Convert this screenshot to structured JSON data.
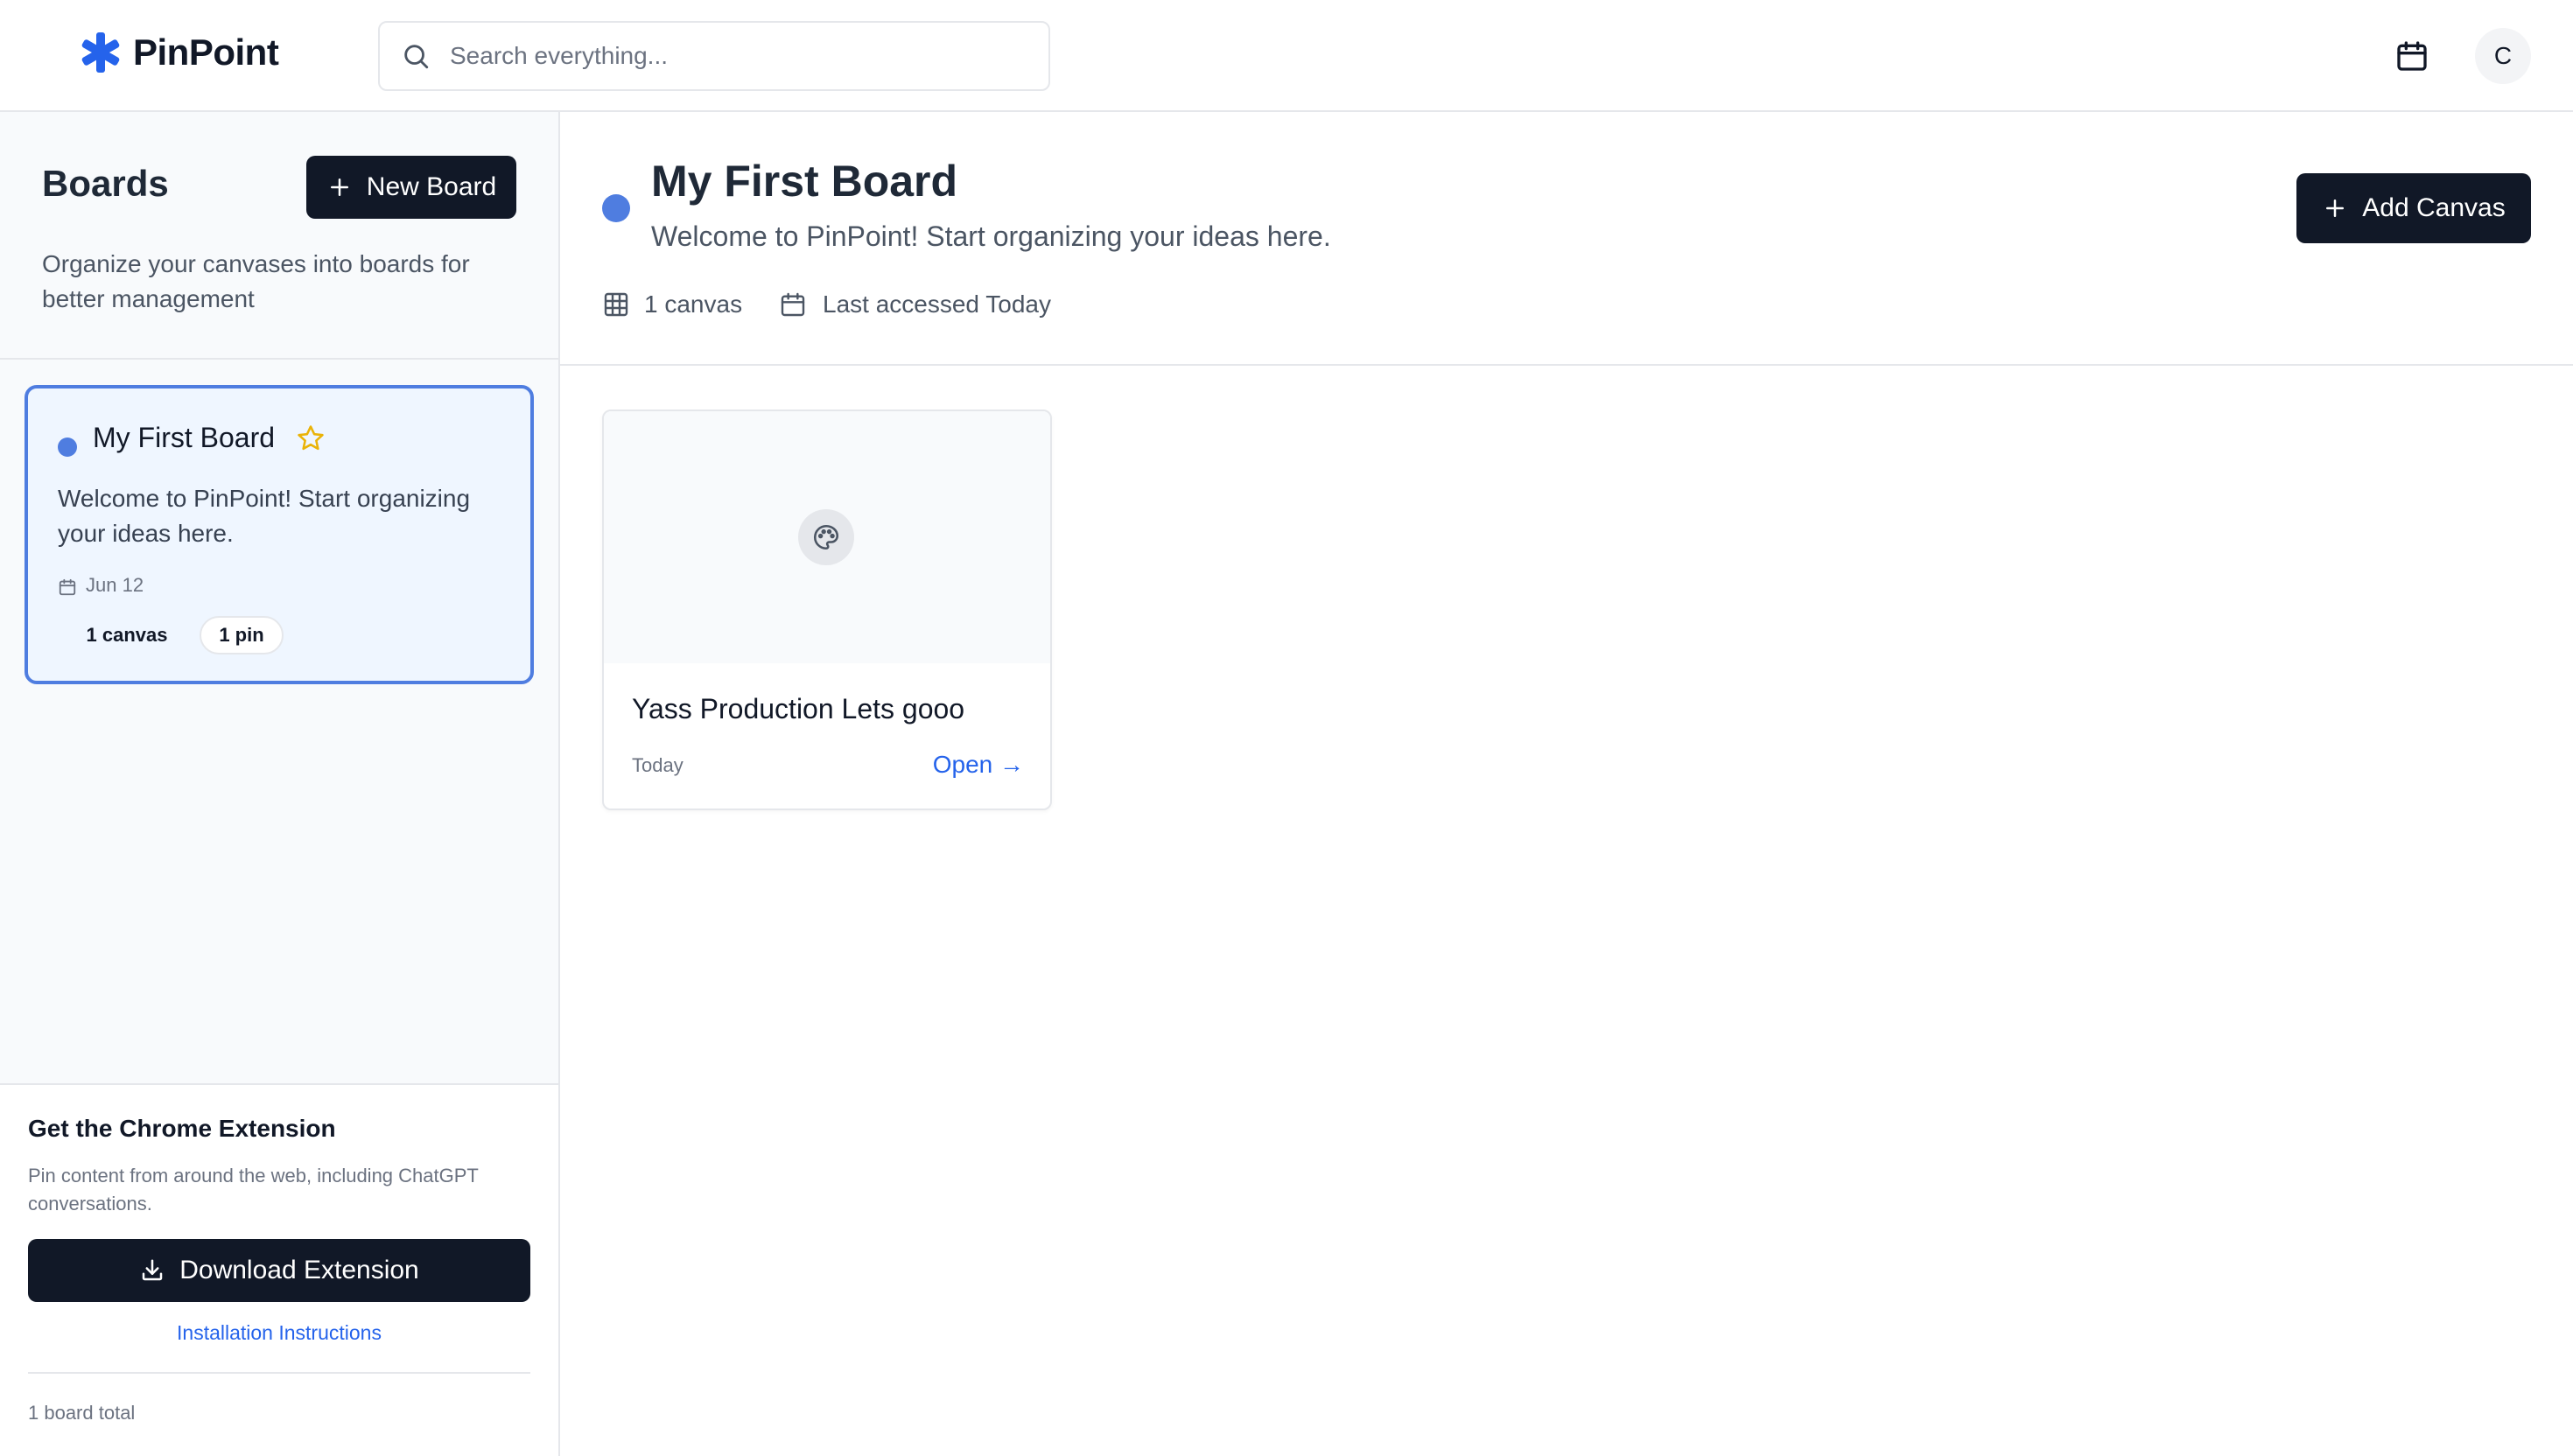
{
  "app": {
    "name": "PinPoint",
    "accent_color": "#4f7de0",
    "search_placeholder": "Search everything...",
    "avatar_initial": "C"
  },
  "sidebar": {
    "title": "Boards",
    "new_board_label": "New Board",
    "description": "Organize your canvases into boards for better management",
    "boards": [
      {
        "title": "My First Board",
        "description": "Welcome to PinPoint! Start organizing your ideas here.",
        "date": "Jun 12",
        "canvas_count": "1 canvas",
        "pin_count": "1 pin",
        "color": "#4f7de0",
        "selected": true
      }
    ],
    "extension": {
      "title": "Get the Chrome Extension",
      "description": "Pin content from around the web, including ChatGPT conversations.",
      "download_label": "Download Extension",
      "instructions_label": "Installation Instructions"
    },
    "total": "1 board total"
  },
  "main": {
    "title": "My First Board",
    "description": "Welcome to PinPoint! Start organizing your ideas here.",
    "canvas_count": "1 canvas",
    "last_accessed": "Last accessed Today",
    "add_canvas_label": "Add Canvas",
    "canvases": [
      {
        "title": "Yass Production Lets gooo",
        "date": "Today",
        "open_label": "Open →"
      }
    ]
  }
}
